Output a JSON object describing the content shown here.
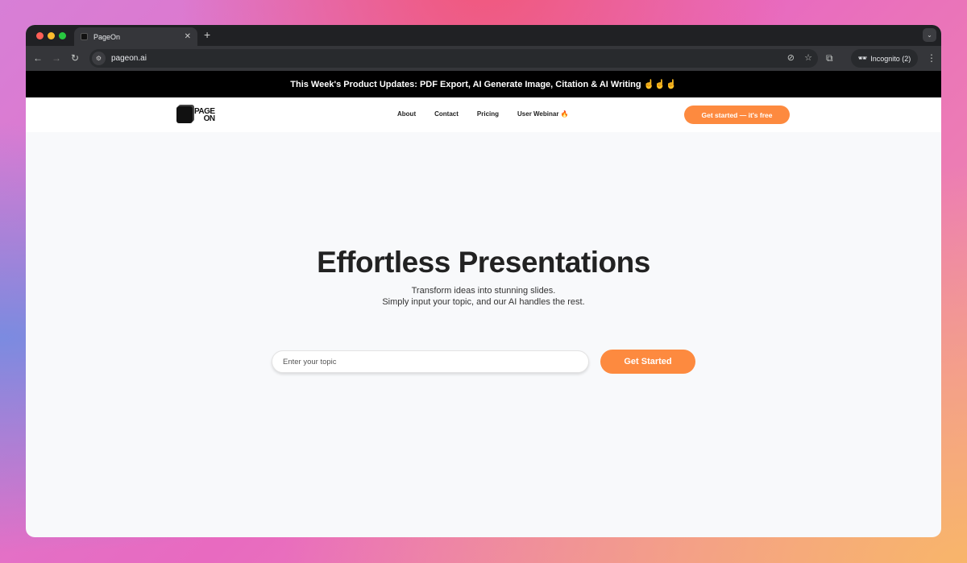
{
  "browser": {
    "tab_title": "PageOn",
    "url": "pageon.ai",
    "incognito_label": "Incognito (2)",
    "icons": [
      "back-icon",
      "forward-icon",
      "reload-icon",
      "site-settings-icon",
      "eye-off-icon",
      "star-icon",
      "extensions-icon",
      "incognito-icon",
      "menu-icon"
    ]
  },
  "banner": {
    "text": "This Week's Product Updates: PDF Export, AI Generate Image, Citation & AI Writing ☝☝☝"
  },
  "nav": {
    "logo_line1": "PAGE",
    "logo_line2": "ON",
    "links": [
      "About",
      "Contact",
      "Pricing",
      "User Webinar 🔥"
    ],
    "cta": "Get started — it's free"
  },
  "hero": {
    "title": "Effortless Presentations",
    "subtitle_line1": "Transform ideas into stunning slides.",
    "subtitle_line2": "Simply input your topic, and our AI handles the rest.",
    "input_placeholder": "Enter your topic",
    "button": "Get Started"
  },
  "colors": {
    "accent": "#fd8a3f",
    "banner_bg": "#000000",
    "page_bg": "#f8f9fb"
  }
}
